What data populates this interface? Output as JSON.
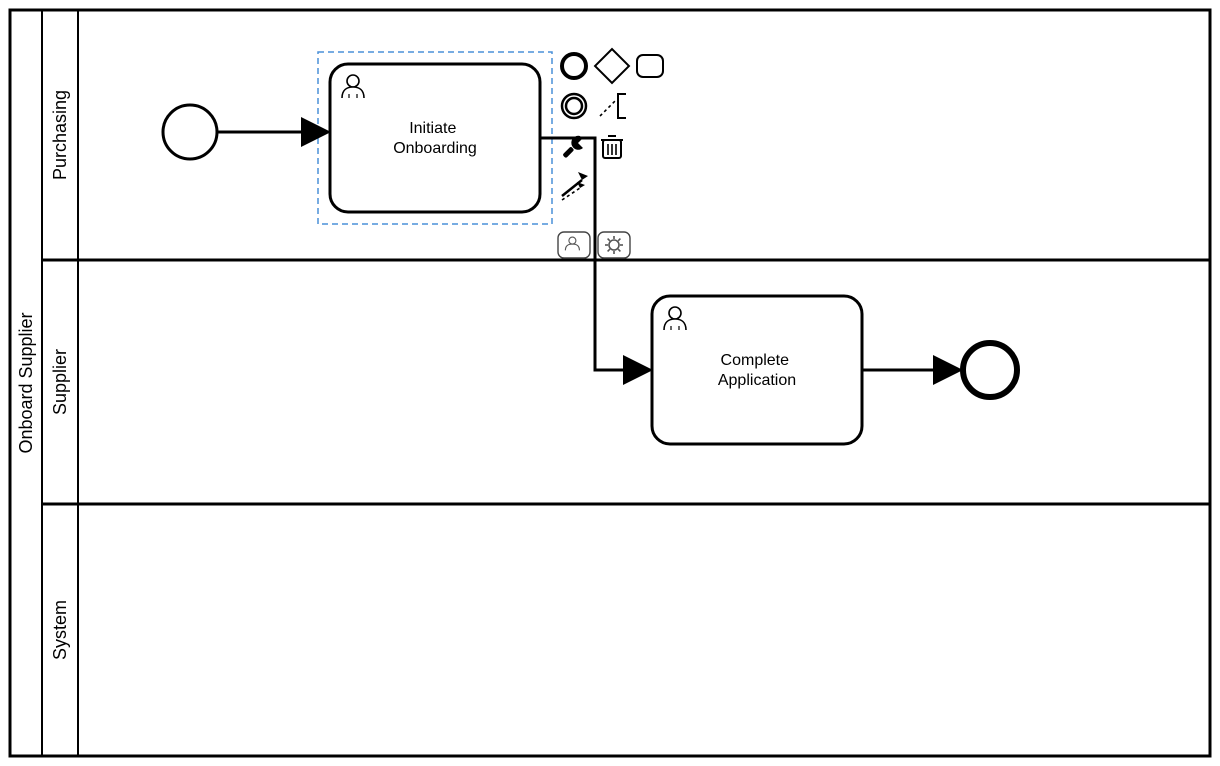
{
  "diagram": {
    "type": "bpmn",
    "pool": {
      "label": "Onboard Supplier"
    },
    "lanes": [
      {
        "id": "lane_purchasing",
        "label": "Purchasing"
      },
      {
        "id": "lane_supplier",
        "label": "Supplier"
      },
      {
        "id": "lane_system",
        "label": "System"
      }
    ],
    "elements": {
      "start_event": {
        "type": "startEvent",
        "lane": "lane_purchasing"
      },
      "task_initiate": {
        "type": "userTask",
        "lane": "lane_purchasing",
        "label_line1": "Initiate",
        "label_line2": "Onboarding",
        "selected": true
      },
      "task_complete": {
        "type": "userTask",
        "lane": "lane_supplier",
        "label_line1": "Complete",
        "label_line2": "Application"
      },
      "end_event": {
        "type": "endEvent",
        "lane": "lane_supplier"
      }
    },
    "flows": [
      {
        "from": "start_event",
        "to": "task_initiate"
      },
      {
        "from": "task_initiate",
        "to": "task_complete"
      },
      {
        "from": "task_complete",
        "to": "end_event"
      }
    ],
    "context_pad": {
      "target": "task_initiate",
      "tools": [
        "append-start-event",
        "append-gateway",
        "append-task",
        "append-end-event",
        "append-annotation",
        "wrench",
        "delete",
        "connect"
      ],
      "replace_options": [
        "user-task",
        "service-task"
      ]
    }
  }
}
